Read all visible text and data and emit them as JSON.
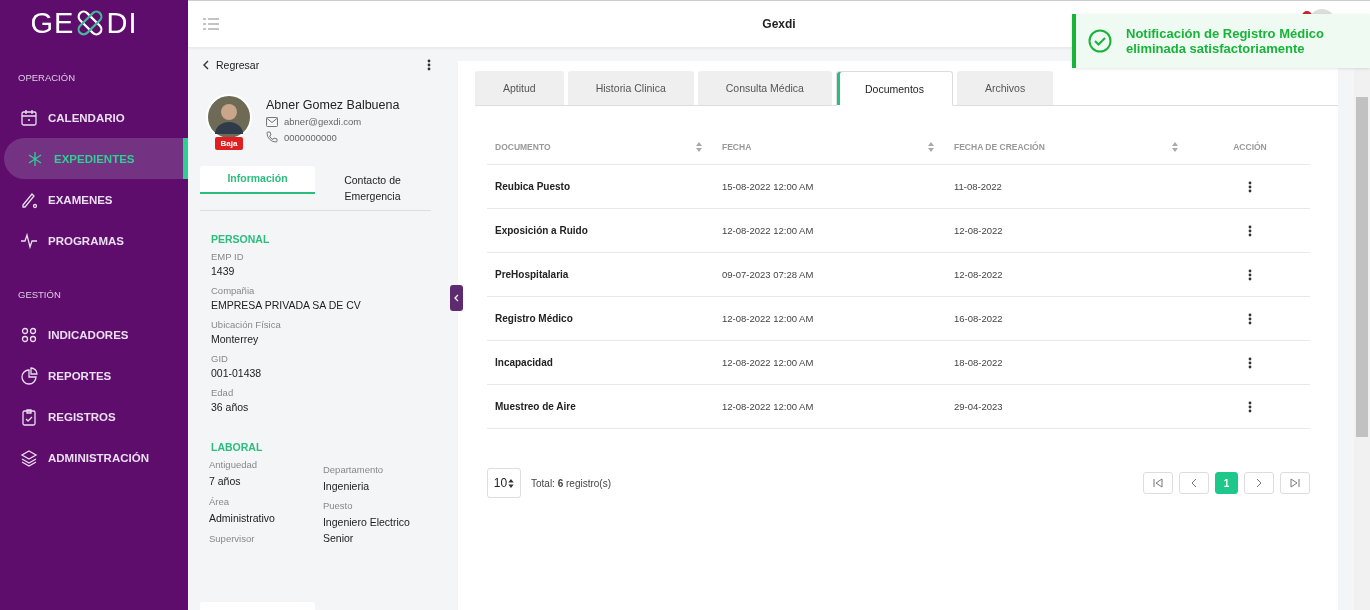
{
  "sidebar": {
    "logo": {
      "left": "GE",
      "right": "DI"
    },
    "sections": [
      {
        "title": "OPERACIÓN",
        "items": [
          {
            "label": "CALENDARIO",
            "selected": false
          },
          {
            "label": "EXPEDIENTES",
            "selected": true
          },
          {
            "label": "EXAMENES",
            "selected": false
          },
          {
            "label": "PROGRAMAS",
            "selected": false
          }
        ]
      },
      {
        "title": "GESTIÓN",
        "items": [
          {
            "label": "INDICADORES",
            "selected": false
          },
          {
            "label": "REPORTES",
            "selected": false
          },
          {
            "label": "REGISTROS",
            "selected": false
          },
          {
            "label": "ADMINISTRACIÓN",
            "selected": false
          }
        ]
      }
    ]
  },
  "header": {
    "title": "Gexdi"
  },
  "toast": {
    "message": "Notificación de Registro Médico eliminada satisfactoriamente"
  },
  "profile": {
    "back": "Regresar",
    "name": "Abner Gomez Balbuena",
    "email": "abner@gexdi.com",
    "phone": "0000000000",
    "status": "Baja",
    "tabs": [
      {
        "label": "Información",
        "selected": true
      },
      {
        "label": "Contacto de Emergencia",
        "selected": false
      }
    ],
    "personal": {
      "title": "PERSONAL",
      "fields": [
        {
          "label": "EMP ID",
          "value": "1439"
        },
        {
          "label": "Compañia",
          "value": "EMPRESA PRIVADA SA DE CV"
        },
        {
          "label": "Ubicación Física",
          "value": "Monterrey"
        },
        {
          "label": "GID",
          "value": "001-01438"
        },
        {
          "label": "Edad",
          "value": "36 años"
        }
      ]
    },
    "laboral": {
      "title": "LABORAL",
      "columns": [
        [
          {
            "label": "Antiguedad",
            "value": "7 años"
          },
          {
            "label": "Área",
            "value": "Administrativo"
          },
          {
            "label": "Supervisor"
          }
        ],
        [
          {
            "label": "Departamento",
            "value": "Ingenieria"
          },
          {
            "label": "Puesto",
            "value": "Ingeniero Electrico Senior"
          }
        ]
      ]
    }
  },
  "tabs": [
    {
      "label": "Aptitud",
      "selected": false
    },
    {
      "label": "Historia Clinica",
      "selected": false
    },
    {
      "label": "Consulta Médica",
      "selected": false
    },
    {
      "label": "Documentos",
      "selected": true
    },
    {
      "label": "Archivos",
      "selected": false
    }
  ],
  "table": {
    "columns": [
      {
        "label": "DOCUMENTO",
        "sortable": true
      },
      {
        "label": "FECHA",
        "sortable": true
      },
      {
        "label": "FECHA DE CREACIÓN",
        "sortable": true
      },
      {
        "label": "ACCIÓN",
        "sortable": false
      }
    ],
    "rows": [
      {
        "documento": "Reubica Puesto",
        "fecha": "15-08-2022 12:00 AM",
        "creacion": "11-08-2022"
      },
      {
        "documento": "Exposición a Ruido",
        "fecha": "12-08-2022 12:00 AM",
        "creacion": "12-08-2022"
      },
      {
        "documento": "PreHospitalaria",
        "fecha": "09-07-2023 07:28 AM",
        "creacion": "12-08-2022"
      },
      {
        "documento": "Registro Médico",
        "fecha": "12-08-2022 12:00 AM",
        "creacion": "16-08-2022"
      },
      {
        "documento": "Incapacidad",
        "fecha": "12-08-2022 12:00 AM",
        "creacion": "18-08-2022"
      },
      {
        "documento": "Muestreo de Aire",
        "fecha": "12-08-2022 12:00 AM",
        "creacion": "29-04-2023"
      }
    ]
  },
  "pager": {
    "page_size": "10",
    "total_label": "Total:",
    "total": "6",
    "total_suffix": "registro(s)",
    "pages": [
      {
        "label": "1",
        "selected": true
      }
    ]
  }
}
